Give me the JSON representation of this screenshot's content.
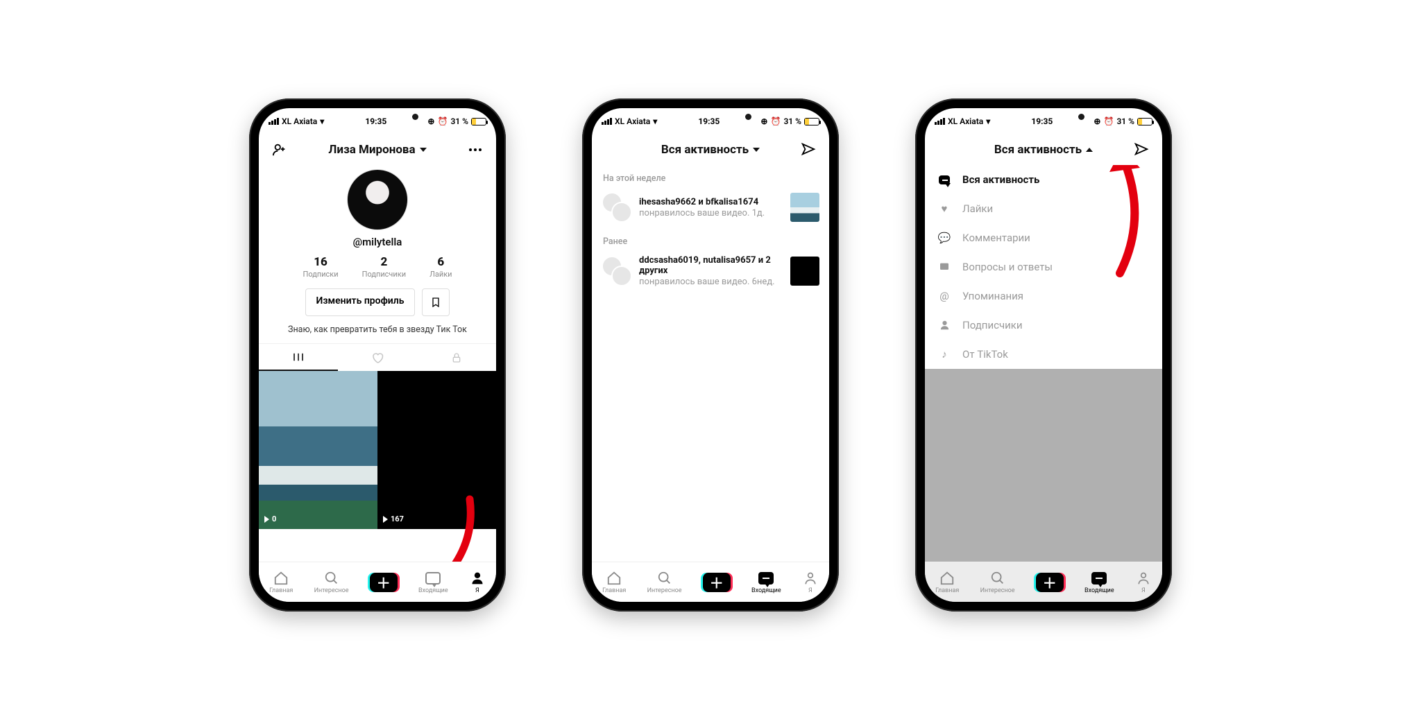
{
  "status": {
    "carrier": "XL Axiata",
    "time": "19:35",
    "battery": "31 %"
  },
  "tabbar": {
    "home": "Главная",
    "discover": "Интересное",
    "inbox": "Входящие",
    "me": "Я"
  },
  "profile": {
    "title": "Лиза Миронова",
    "username": "@milytella",
    "stats": [
      {
        "n": "16",
        "l": "Подписки"
      },
      {
        "n": "2",
        "l": "Подписчики"
      },
      {
        "n": "6",
        "l": "Лайки"
      }
    ],
    "edit": "Изменить профиль",
    "bio": "Знаю, как превратить тебя в звезду Тик Ток",
    "views": [
      "0",
      "167"
    ]
  },
  "inbox": {
    "title": "Вся активность",
    "sections": [
      {
        "header": "На этой неделе",
        "rows": [
          {
            "who": "ihesasha9662 и bfkalisa1674",
            "what": "понравилось ваше видео. 1д.",
            "thumb": "beach"
          }
        ]
      },
      {
        "header": "Ранее",
        "rows": [
          {
            "who": "ddcsasha6019, nutalisa9657 и 2 других",
            "what": "понравилось ваше видео. 6нед.",
            "thumb": "black"
          }
        ]
      }
    ]
  },
  "filter": {
    "title": "Вся активность",
    "items": [
      {
        "label": "Вся активность",
        "icon": "chat",
        "active": true
      },
      {
        "label": "Лайки",
        "icon": "heart"
      },
      {
        "label": "Комментарии",
        "icon": "comment"
      },
      {
        "label": "Вопросы и ответы",
        "icon": "qa"
      },
      {
        "label": "Упоминания",
        "icon": "at"
      },
      {
        "label": "Подписчики",
        "icon": "person"
      },
      {
        "label": "От TikTok",
        "icon": "tiktok"
      }
    ]
  }
}
